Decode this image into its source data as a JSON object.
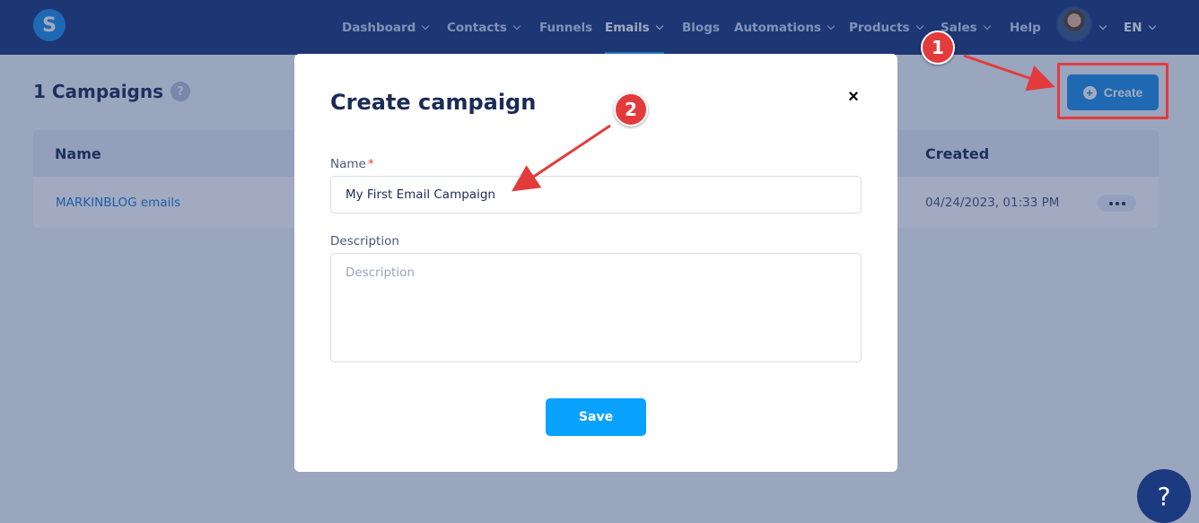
{
  "nav": {
    "logo_letter": "S",
    "items": [
      {
        "label": "Dashboard",
        "has_dropdown": true
      },
      {
        "label": "Contacts",
        "has_dropdown": true
      },
      {
        "label": "Funnels",
        "has_dropdown": false
      },
      {
        "label": "Emails",
        "has_dropdown": true,
        "active": true
      },
      {
        "label": "Blogs",
        "has_dropdown": false
      },
      {
        "label": "Automations",
        "has_dropdown": true
      },
      {
        "label": "Products",
        "has_dropdown": true
      },
      {
        "label": "Sales",
        "has_dropdown": true
      },
      {
        "label": "Help",
        "has_dropdown": false
      }
    ],
    "language": "EN"
  },
  "page": {
    "title": "1 Campaigns",
    "help_badge": "?",
    "create_label": "Create"
  },
  "table": {
    "columns": [
      "Name",
      "Created"
    ],
    "rows": [
      {
        "name": "MARKINBLOG emails",
        "created": "04/24/2023, 01:33 PM"
      }
    ]
  },
  "modal": {
    "title": "Create campaign",
    "close_symbol": "×",
    "name_label": "Name",
    "required_mark": "*",
    "name_value": "My First Email Campaign",
    "description_label": "Description",
    "description_placeholder": "Description",
    "save_label": "Save"
  },
  "annotations": {
    "step1": "1",
    "step2": "2",
    "color": "#e33b3b"
  },
  "help_bubble": "?",
  "colors": {
    "nav_bg": "#1c3a7f",
    "accent": "#1e90e6",
    "save": "#0aa2ff"
  }
}
